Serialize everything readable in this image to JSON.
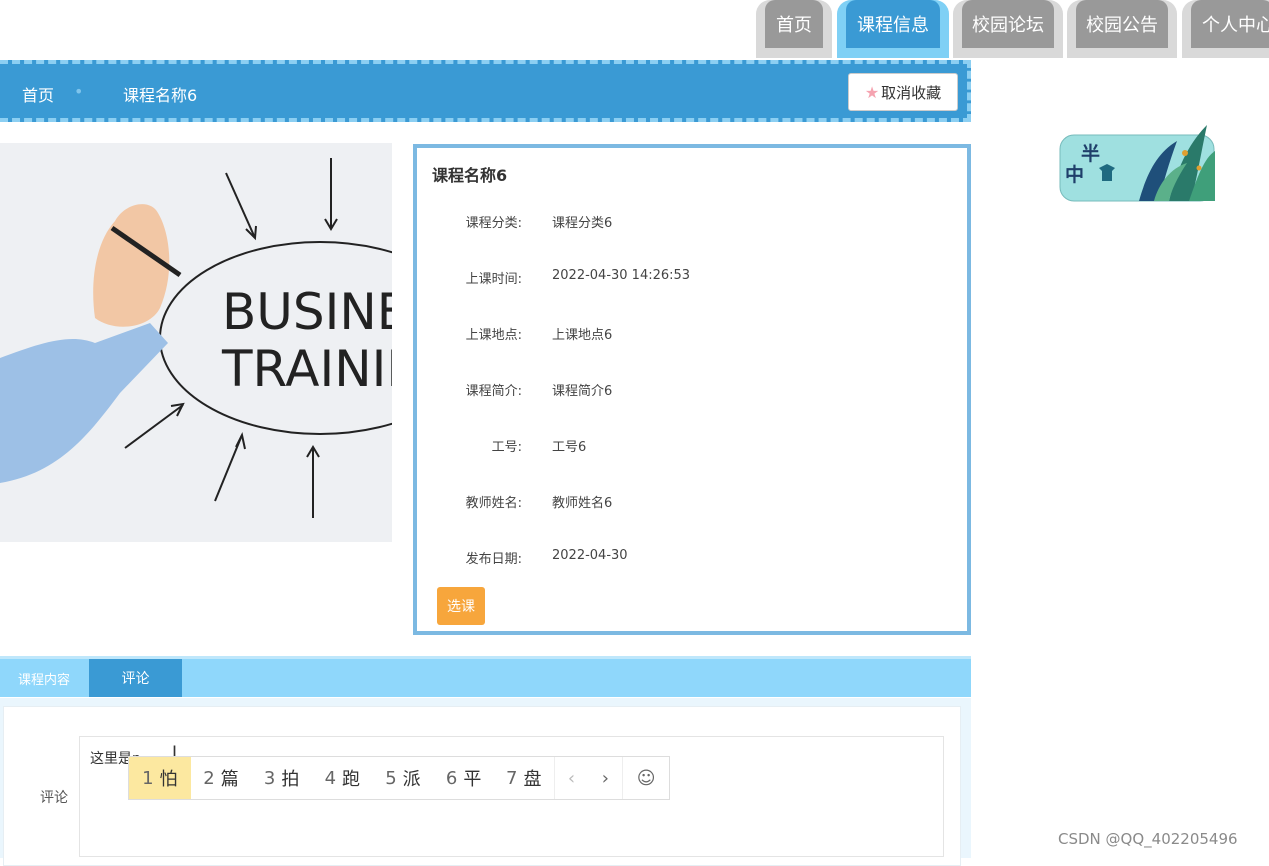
{
  "nav": {
    "tabs": [
      {
        "label": "首页"
      },
      {
        "label": "课程信息",
        "active": true
      },
      {
        "label": "校园论坛"
      },
      {
        "label": "校园公告"
      },
      {
        "label": "个人中心"
      }
    ]
  },
  "breadcrumb": {
    "home": "首页",
    "current": "课程名称6",
    "unfavorite_label": "取消收藏"
  },
  "course_image": {
    "line1": "BUSINES",
    "line2": "TRAININ"
  },
  "course": {
    "title": "课程名称6",
    "fields": [
      {
        "label": "课程分类:",
        "value": "课程分类6"
      },
      {
        "label": "上课时间:",
        "value": "2022-04-30 14:26:53"
      },
      {
        "label": "上课地点:",
        "value": "上课地点6"
      },
      {
        "label": "课程简介:",
        "value": "课程简介6"
      },
      {
        "label": "工号:",
        "value": "工号6"
      },
      {
        "label": "教师姓名:",
        "value": "教师姓名6"
      },
      {
        "label": "发布日期:",
        "value": "2022-04-30"
      }
    ],
    "select_label": "选课"
  },
  "sticker": {
    "text1": "半",
    "text2": "中"
  },
  "detail_tabs": [
    {
      "label": "课程内容"
    },
    {
      "label": "评论",
      "active": true
    }
  ],
  "comment": {
    "label": "评论",
    "input_value": "这里是p"
  },
  "ime": {
    "candidates": [
      {
        "num": "1",
        "char": "怕"
      },
      {
        "num": "2",
        "char": "篇"
      },
      {
        "num": "3",
        "char": "拍"
      },
      {
        "num": "4",
        "char": "跑"
      },
      {
        "num": "5",
        "char": "派"
      },
      {
        "num": "6",
        "char": "平"
      },
      {
        "num": "7",
        "char": "盘"
      }
    ],
    "prev": "‹",
    "next": "›",
    "emoji": "☺"
  },
  "watermark": "CSDN @QQ_402205496"
}
